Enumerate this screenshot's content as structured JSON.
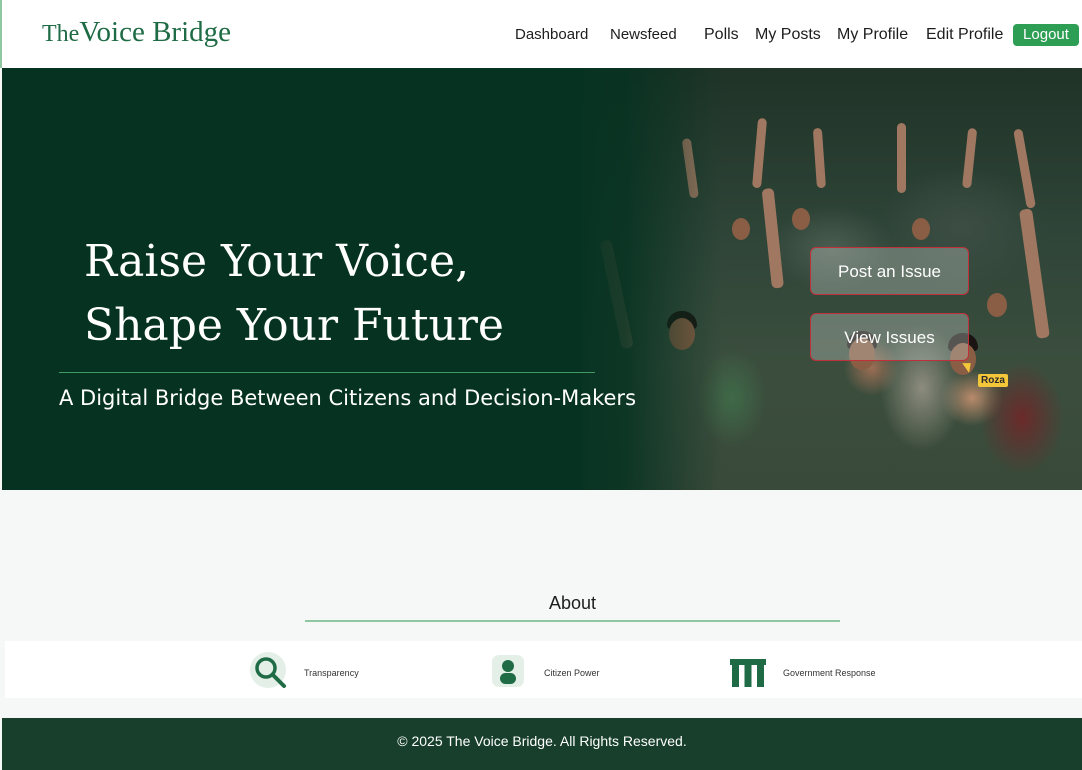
{
  "header": {
    "logo_small": "The",
    "logo_big": "Voice Bridge",
    "nav": [
      "Dashboard",
      "Newsfeed",
      "Polls",
      "My Posts",
      "My Profile",
      "Edit Profile"
    ],
    "logout_label": "Logout"
  },
  "hero": {
    "title_line1": "Raise Your Voice,",
    "title_line2": "Shape Your Future",
    "subtitle": "A Digital Bridge Between Citizens and Decision-Makers",
    "post_issue_label": "Post an Issue",
    "view_issues_label": "View Issues",
    "cursor_label": "Roza"
  },
  "about": {
    "title": "About",
    "features": [
      {
        "label": "Transparency",
        "icon": "magnifier-icon"
      },
      {
        "label": "Citizen Power",
        "icon": "person-icon"
      },
      {
        "label": "Government Response",
        "icon": "government-building-icon"
      }
    ]
  },
  "footer": {
    "copyright": "© 2025 The Voice Bridge. All Rights Reserved."
  },
  "colors": {
    "brand_green": "#1f6b45",
    "hero_bg": "#063221",
    "logout_bg": "#2e9e55",
    "footer_bg": "#173f2c",
    "button_border": "#c0303a"
  }
}
